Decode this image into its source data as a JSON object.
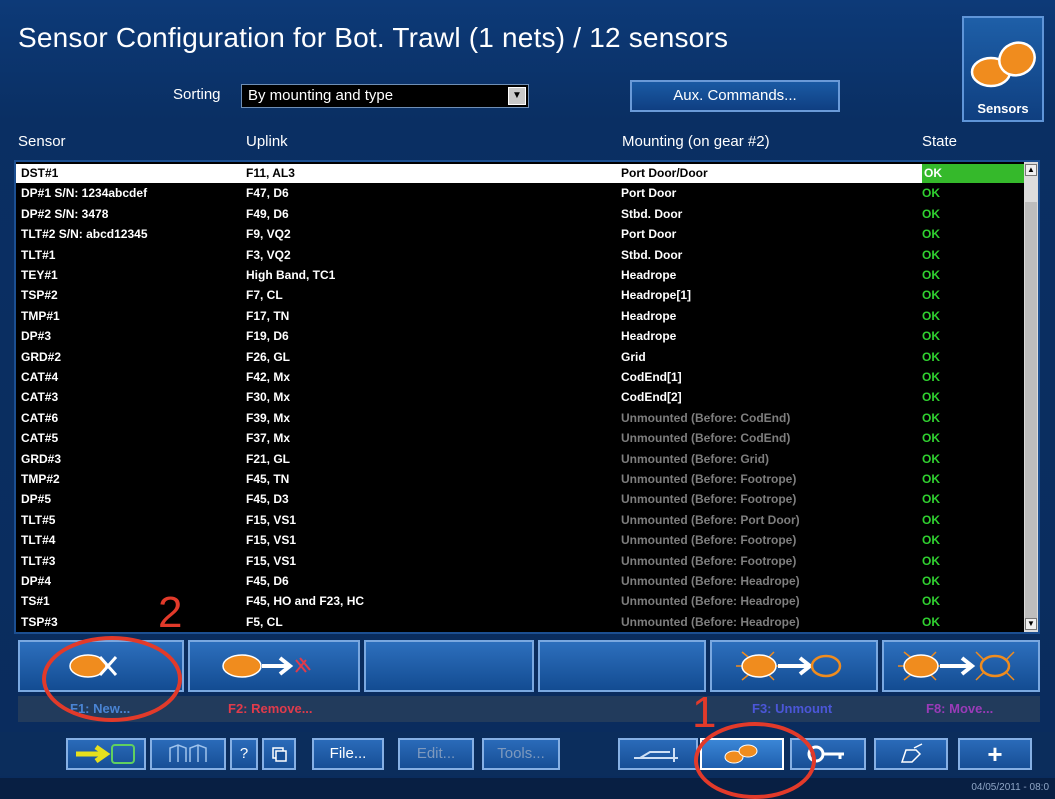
{
  "window": {
    "title": "Sensor Configuration for Bot. Trawl (1 nets) / 12 sensors",
    "sensors_button_label": "Sensors"
  },
  "sorting": {
    "label": "Sorting",
    "selected": "By mounting and type"
  },
  "aux_button_label": "Aux. Commands...",
  "table": {
    "headers": {
      "sensor": "Sensor",
      "uplink": "Uplink",
      "mounting": "Mounting (on gear #2)",
      "state": "State"
    },
    "rows": [
      {
        "sensor": "DST#1",
        "uplink": "F11, AL3",
        "mounting": "Port Door/Door",
        "state": "OK"
      },
      {
        "sensor": "DP#1 S/N: 1234abcdef",
        "uplink": "F47, D6",
        "mounting": "Port Door",
        "state": "OK"
      },
      {
        "sensor": "DP#2 S/N: 3478",
        "uplink": "F49, D6",
        "mounting": "Stbd. Door",
        "state": "OK"
      },
      {
        "sensor": "TLT#2 S/N: abcd12345",
        "uplink": "F9, VQ2",
        "mounting": "Port Door",
        "state": "OK"
      },
      {
        "sensor": "TLT#1",
        "uplink": "F3, VQ2",
        "mounting": "Stbd. Door",
        "state": "OK"
      },
      {
        "sensor": "TEY#1",
        "uplink": "High Band, TC1",
        "mounting": "Headrope",
        "state": "OK"
      },
      {
        "sensor": "TSP#2",
        "uplink": "F7, CL",
        "mounting": "Headrope[1]",
        "state": "OK"
      },
      {
        "sensor": "TMP#1",
        "uplink": "F17, TN",
        "mounting": "Headrope",
        "state": "OK"
      },
      {
        "sensor": "DP#3",
        "uplink": "F19, D6",
        "mounting": "Headrope",
        "state": "OK"
      },
      {
        "sensor": "GRD#2",
        "uplink": "F26, GL",
        "mounting": "Grid",
        "state": "OK"
      },
      {
        "sensor": "CAT#4",
        "uplink": "F42, Mx",
        "mounting": "CodEnd[1]",
        "state": "OK"
      },
      {
        "sensor": "CAT#3",
        "uplink": "F30, Mx",
        "mounting": "CodEnd[2]",
        "state": "OK"
      },
      {
        "sensor": "CAT#6",
        "uplink": "F39, Mx",
        "mounting": "Unmounted (Before: CodEnd)",
        "state": "OK"
      },
      {
        "sensor": "CAT#5",
        "uplink": "F37, Mx",
        "mounting": "Unmounted (Before: CodEnd)",
        "state": "OK"
      },
      {
        "sensor": "GRD#3",
        "uplink": "F21, GL",
        "mounting": "Unmounted (Before: Grid)",
        "state": "OK"
      },
      {
        "sensor": "TMP#2",
        "uplink": "F45, TN",
        "mounting": "Unmounted (Before: Footrope)",
        "state": "OK"
      },
      {
        "sensor": "DP#5",
        "uplink": "F45, D3",
        "mounting": "Unmounted (Before: Footrope)",
        "state": "OK"
      },
      {
        "sensor": "TLT#5",
        "uplink": "F15, VS1",
        "mounting": "Unmounted (Before: Port Door)",
        "state": "OK"
      },
      {
        "sensor": "TLT#4",
        "uplink": "F15, VS1",
        "mounting": "Unmounted (Before: Footrope)",
        "state": "OK"
      },
      {
        "sensor": "TLT#3",
        "uplink": "F15, VS1",
        "mounting": "Unmounted (Before: Footrope)",
        "state": "OK"
      },
      {
        "sensor": "DP#4",
        "uplink": "F45, D6",
        "mounting": "Unmounted (Before: Headrope)",
        "state": "OK"
      },
      {
        "sensor": "TS#1",
        "uplink": "F45, HO and F23, HC",
        "mounting": "Unmounted (Before: Headrope)",
        "state": "OK"
      },
      {
        "sensor": "TSP#3",
        "uplink": "F5, CL",
        "mounting": "Unmounted (Before: Headrope)",
        "state": "OK"
      }
    ]
  },
  "function_keys": {
    "f1": "F1: New...",
    "f2": "F2: Remove...",
    "f3": "F3: Unmount",
    "f8": "F8: Move..."
  },
  "toolbar": {
    "help": "?",
    "file": "File...",
    "edit": "Edit...",
    "tools": "Tools...",
    "add": "+"
  },
  "status": {
    "datetime": "04/05/2011 - 08:0"
  },
  "annotations": {
    "one": "1",
    "two": "2"
  },
  "colors": {
    "accent": "#35b92b",
    "highlight": "#e23a2a",
    "sensor_orange": "#f08c1e",
    "f1": "#4a84d4",
    "f2": "#e03b4b",
    "f3": "#4b56d8",
    "f8": "#9a3bb8"
  }
}
